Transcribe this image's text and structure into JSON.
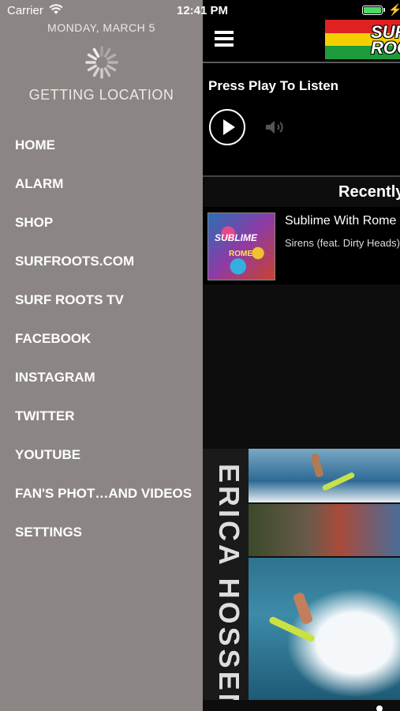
{
  "status_bar": {
    "carrier": "Carrier",
    "time": "12:41 PM",
    "wifi_icon": "wifi-icon",
    "battery_level": 1.0,
    "battery_color": "#4cd964",
    "charging_icon": "bolt-icon"
  },
  "drawer": {
    "date": "MONDAY, MARCH 5",
    "location_status": "GETTING LOCATION",
    "spinner_icon": "activity-spinner-icon",
    "menu_items": [
      {
        "label": "HOME"
      },
      {
        "label": "ALARM"
      },
      {
        "label": "SHOP"
      },
      {
        "label": "SURFROOTS.COM"
      },
      {
        "label": "SURF ROOTS TV"
      },
      {
        "label": "FACEBOOK"
      },
      {
        "label": "INSTAGRAM"
      },
      {
        "label": "TWITTER"
      },
      {
        "label": "YOUTUBE"
      },
      {
        "label": "FAN'S PHOT…AND VIDEOS"
      },
      {
        "label": "SETTINGS"
      }
    ],
    "background_color": "#8b8683"
  },
  "header": {
    "menu_icon": "hamburger-icon",
    "logo_text": "SURF ROOTS",
    "logo_colors": [
      "#e02121",
      "#f5d000",
      "#1e9b3a"
    ]
  },
  "player": {
    "prompt": "Press Play To Listen",
    "play_icon": "play-icon",
    "volume_icon": "speaker-icon"
  },
  "recently_played": {
    "title": "Recently",
    "items": [
      {
        "artist": "Sublime With Rome",
        "song": "Sirens (feat. Dirty Heads)",
        "album_art_text": [
          "SUBLIME",
          "ROME"
        ]
      }
    ]
  },
  "banner": {
    "name_text": "ERICA HOSSENI"
  },
  "pager": {
    "page_count": 2,
    "current_page": 1
  }
}
